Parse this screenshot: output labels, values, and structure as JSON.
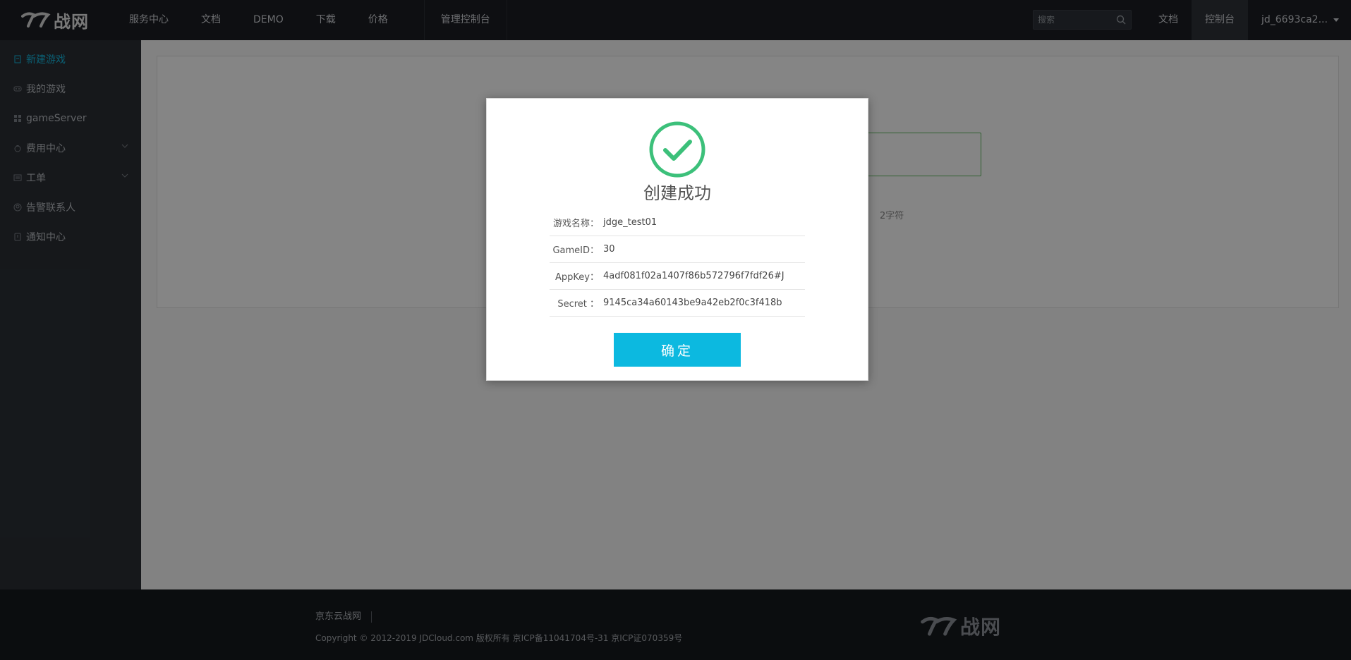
{
  "header": {
    "logo_text": "战网",
    "nav": [
      "服务中心",
      "文档",
      "DEMO",
      "下载",
      "价格"
    ],
    "console_label": "管理控制台",
    "search_placeholder": "搜索",
    "right_nav": {
      "docs": "文档",
      "console": "控制台",
      "user": "jd_6693ca2..."
    }
  },
  "sidebar": {
    "items": [
      {
        "label": "新建游戏",
        "icon": "new-game-icon",
        "active": true
      },
      {
        "label": "我的游戏",
        "icon": "gamepad-icon"
      },
      {
        "label": "gameServer",
        "icon": "grid-icon"
      },
      {
        "label": "费用中心",
        "icon": "money-bag-icon",
        "expandable": true
      },
      {
        "label": "工单",
        "icon": "ticket-icon",
        "expandable": true
      },
      {
        "label": "告警联系人",
        "icon": "contact-icon"
      },
      {
        "label": "通知中心",
        "icon": "notice-icon"
      }
    ]
  },
  "main": {
    "hint_fragment": "2字符"
  },
  "modal": {
    "title": "创建成功",
    "fields": [
      {
        "key": "游戏名称：",
        "value": "jdge_test01"
      },
      {
        "key": "GameID：",
        "value": "30"
      },
      {
        "key": "AppKey：",
        "value": "4adf081f02a1407f86b572796f7fdf26#J"
      },
      {
        "key": "Secret ：",
        "value": "9145ca34a60143be9a42eb2f0c3f418b"
      }
    ],
    "confirm_label": "确定"
  },
  "footer": {
    "link": "京东云战网",
    "copyright": "Copyright © 2012-2019 JDCloud.com 版权所有 京ICP备11041704号-31 京ICP证070359号",
    "logo_text": "战网"
  },
  "colors": {
    "accent": "#0cb9e0",
    "success": "#3cc07a",
    "topbar": "#1b1e23",
    "sidebar": "#2b2f35"
  }
}
